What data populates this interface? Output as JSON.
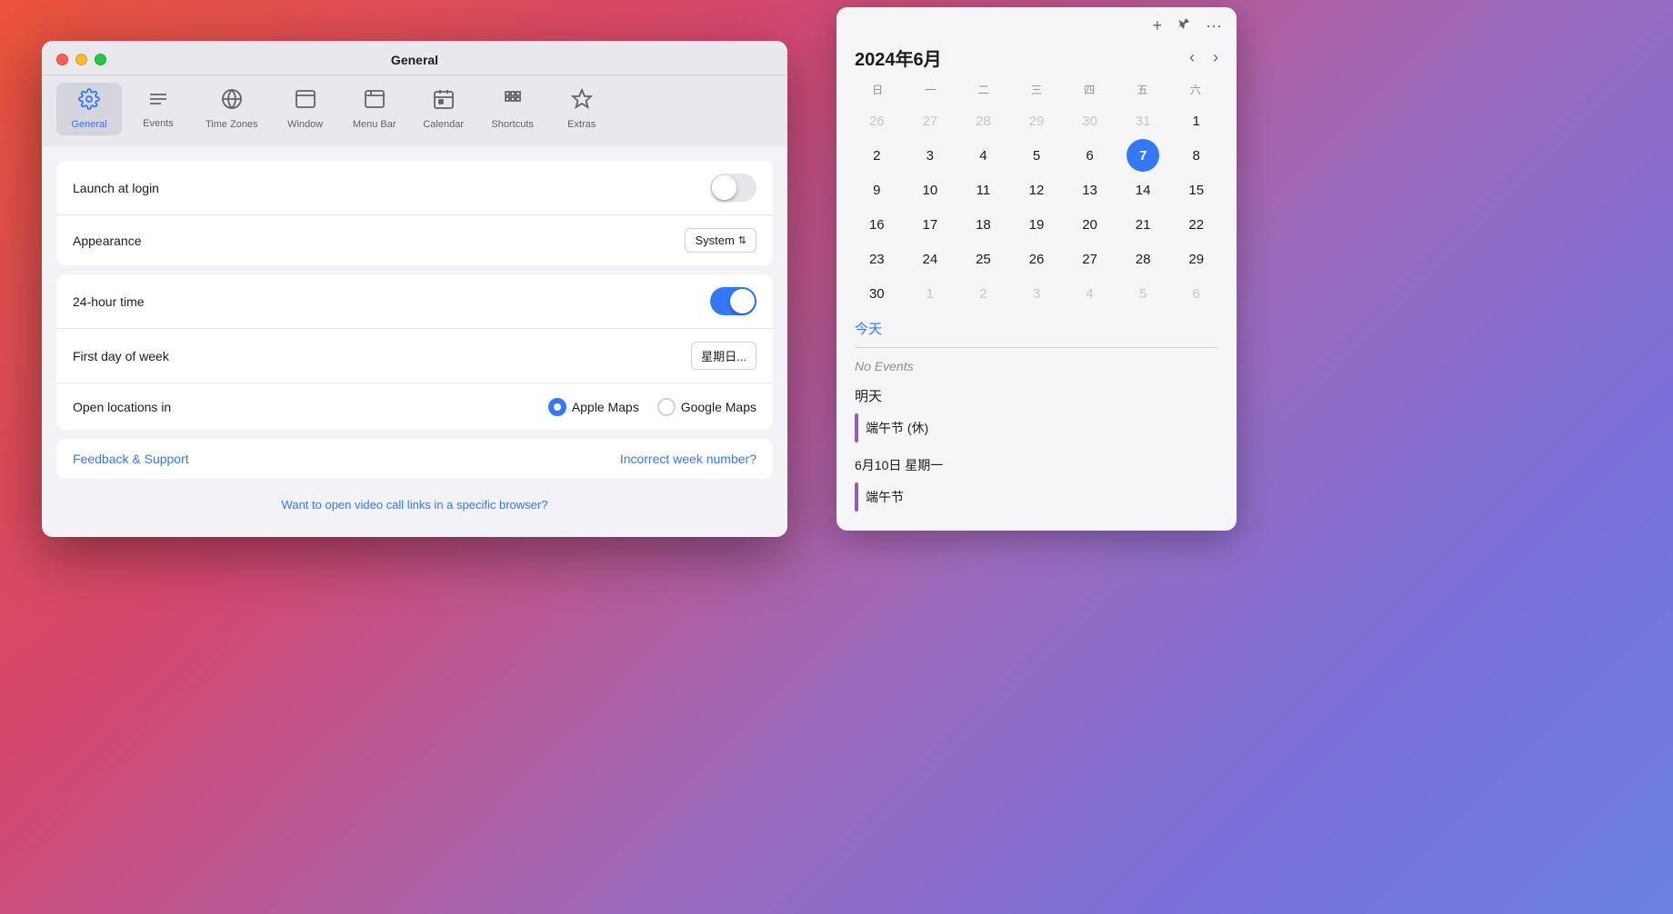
{
  "settings_window": {
    "title": "General",
    "toolbar": {
      "items": [
        {
          "id": "general",
          "label": "General",
          "icon": "⚙️",
          "active": true
        },
        {
          "id": "events",
          "label": "Events",
          "icon": "≡",
          "active": false
        },
        {
          "id": "timezones",
          "label": "Time Zones",
          "icon": "🌐",
          "active": false
        },
        {
          "id": "window",
          "label": "Window",
          "icon": "▭",
          "active": false
        },
        {
          "id": "menubar",
          "label": "Menu Bar",
          "icon": "⬜",
          "active": false
        },
        {
          "id": "calendar",
          "label": "Calendar",
          "icon": "📅",
          "active": false
        },
        {
          "id": "shortcuts",
          "label": "Shortcuts",
          "icon": "⌘",
          "active": false
        },
        {
          "id": "extras",
          "label": "Extras",
          "icon": "✦",
          "active": false
        }
      ]
    },
    "rows": {
      "launch_at_login_label": "Launch at login",
      "launch_at_login_toggle": "off",
      "appearance_label": "Appearance",
      "appearance_value": "System",
      "appearance_arrow": "⇅",
      "hour24_label": "24-hour time",
      "hour24_toggle": "on",
      "first_day_label": "First day of week",
      "first_day_value": "星期日...",
      "open_locations_label": "Open locations in",
      "apple_maps_label": "Apple Maps",
      "google_maps_label": "Google Maps"
    },
    "links": {
      "feedback": "Feedback & Support",
      "incorrect_week": "Incorrect week number?",
      "video_call": "Want to open video call links in a specific browser?"
    }
  },
  "calendar": {
    "month_title": "2024年6月",
    "weekdays": [
      "日",
      "一",
      "二",
      "三",
      "四",
      "五",
      "六"
    ],
    "today_label": "今天",
    "no_events": "No Events",
    "tomorrow_label": "明天",
    "event1": "端午节 (休)",
    "date2_label": "6月10日 星期一",
    "event2": "端午节",
    "nav_prev": "‹",
    "nav_next": "›",
    "days": [
      {
        "day": "26",
        "type": "other"
      },
      {
        "day": "27",
        "type": "other"
      },
      {
        "day": "28",
        "type": "other"
      },
      {
        "day": "29",
        "type": "other"
      },
      {
        "day": "30",
        "type": "other"
      },
      {
        "day": "31",
        "type": "other"
      },
      {
        "day": "1",
        "type": "normal"
      },
      {
        "day": "2",
        "type": "normal"
      },
      {
        "day": "3",
        "type": "normal"
      },
      {
        "day": "4",
        "type": "normal"
      },
      {
        "day": "5",
        "type": "normal"
      },
      {
        "day": "6",
        "type": "normal"
      },
      {
        "day": "7",
        "type": "today"
      },
      {
        "day": "8",
        "type": "normal"
      },
      {
        "day": "9",
        "type": "normal"
      },
      {
        "day": "10",
        "type": "normal"
      },
      {
        "day": "11",
        "type": "normal"
      },
      {
        "day": "12",
        "type": "normal"
      },
      {
        "day": "13",
        "type": "normal"
      },
      {
        "day": "14",
        "type": "normal"
      },
      {
        "day": "15",
        "type": "normal"
      },
      {
        "day": "16",
        "type": "normal"
      },
      {
        "day": "17",
        "type": "normal"
      },
      {
        "day": "18",
        "type": "normal"
      },
      {
        "day": "19",
        "type": "normal"
      },
      {
        "day": "20",
        "type": "normal"
      },
      {
        "day": "21",
        "type": "normal"
      },
      {
        "day": "22",
        "type": "normal"
      },
      {
        "day": "23",
        "type": "normal"
      },
      {
        "day": "24",
        "type": "normal"
      },
      {
        "day": "25",
        "type": "normal"
      },
      {
        "day": "26",
        "type": "normal"
      },
      {
        "day": "27",
        "type": "normal"
      },
      {
        "day": "28",
        "type": "normal"
      },
      {
        "day": "29",
        "type": "normal"
      },
      {
        "day": "30",
        "type": "normal"
      },
      {
        "day": "1",
        "type": "other"
      },
      {
        "day": "2",
        "type": "other"
      },
      {
        "day": "3",
        "type": "other"
      },
      {
        "day": "4",
        "type": "other"
      },
      {
        "day": "5",
        "type": "other"
      },
      {
        "day": "6",
        "type": "other"
      }
    ]
  }
}
